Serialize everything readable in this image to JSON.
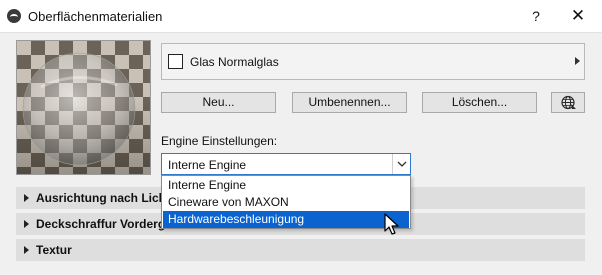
{
  "window": {
    "title": "Oberflächenmaterialien",
    "help_label": "?",
    "close_label": "✕"
  },
  "material": {
    "name": "Glas Normalglas"
  },
  "buttons": {
    "new_label": "Neu...",
    "rename_label": "Umbenennen...",
    "delete_label": "Löschen..."
  },
  "engine": {
    "label": "Engine Einstellungen:",
    "selected": "Interne Engine",
    "options": [
      "Interne Engine",
      "Cineware von MAXON",
      "Hardwarebeschleunigung"
    ],
    "highlighted_index": 2
  },
  "sections": [
    {
      "label": "Ausrichtung nach Licht"
    },
    {
      "label": "Deckschraffur Vordergru"
    },
    {
      "label": "Textur"
    }
  ],
  "icons": {
    "app": "archicad-logo-icon",
    "arrow": "chevron-right-icon",
    "globe": "globe-icon",
    "dropdown": "chevron-down-icon",
    "pointer": "mouse-cursor-icon"
  },
  "colors": {
    "highlight": "#0a63cf",
    "focus_border": "#2f7bd1",
    "dialog_bg": "#f0f0f0",
    "section_bg": "#dedede"
  }
}
